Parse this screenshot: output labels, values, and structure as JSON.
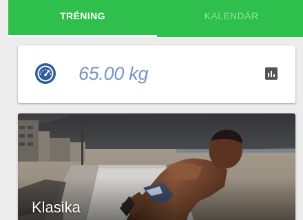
{
  "tabs": [
    {
      "label": "TRÉNING",
      "active": true
    },
    {
      "label": "KALENDÁR",
      "active": false
    }
  ],
  "weight": {
    "value": "65.00 kg",
    "icon": "speedometer-icon"
  },
  "chart_button": {
    "icon": "bar-chart-icon"
  },
  "workout": {
    "title": "Klasika",
    "image": "man-doing-pushups-on-beach-promenade"
  },
  "colors": {
    "primary": "#2fbf4c",
    "gauge_blue": "#2e5a9e",
    "weight_text": "#7a93c4",
    "chart_icon": "#555555"
  }
}
